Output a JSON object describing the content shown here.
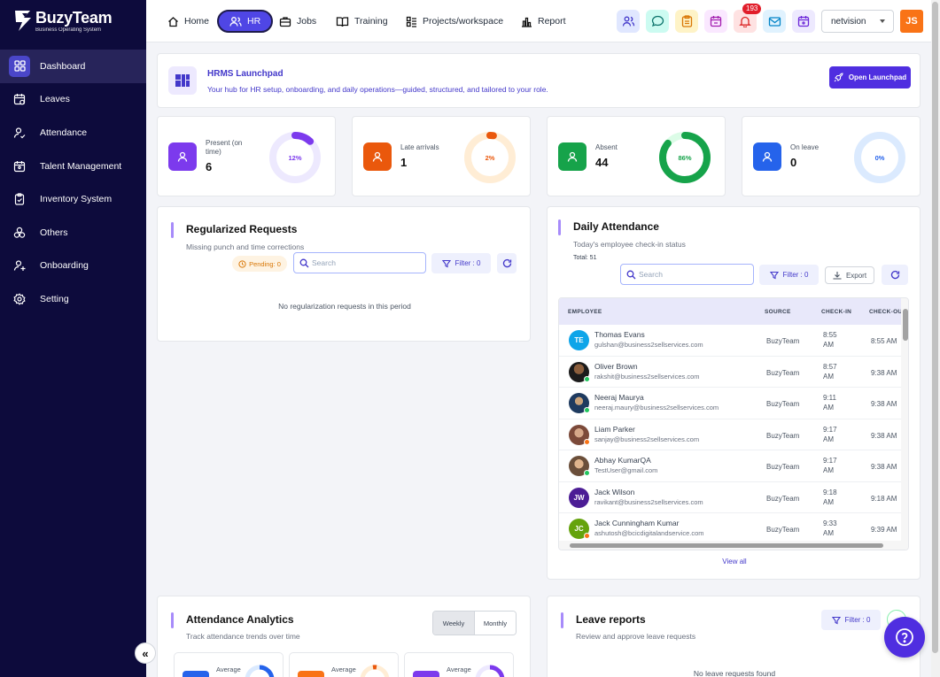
{
  "brand": {
    "name": "BuzyTeam",
    "tagline": "Business Operating System"
  },
  "sidebar": {
    "items": [
      {
        "label": "Dashboard",
        "icon": "grid-icon"
      },
      {
        "label": "Leaves",
        "icon": "calendar-icon"
      },
      {
        "label": "Attendance",
        "icon": "user-check-icon"
      },
      {
        "label": "Talent Management",
        "icon": "calendar-user-icon"
      },
      {
        "label": "Inventory System",
        "icon": "clipboard-icon"
      },
      {
        "label": "Others",
        "icon": "circles-icon"
      },
      {
        "label": "Onboarding",
        "icon": "user-plus-icon"
      },
      {
        "label": "Setting",
        "icon": "gear-icon"
      }
    ],
    "active": "Dashboard",
    "collapse_glyph": "«"
  },
  "topnav": {
    "tabs": [
      {
        "label": "Home",
        "icon": "home-icon"
      },
      {
        "label": "HR",
        "icon": "users-icon"
      },
      {
        "label": "Jobs",
        "icon": "briefcase-icon"
      },
      {
        "label": "Training",
        "icon": "book-icon"
      },
      {
        "label": "Projects/workspace",
        "icon": "workspace-icon"
      },
      {
        "label": "Report",
        "icon": "bar-chart-icon"
      }
    ],
    "active_tab": "HR",
    "notification_count": "193",
    "org_select": "netvision",
    "user_initials": "JS"
  },
  "launchpad": {
    "title": "HRMS Launchpad",
    "subtitle": "Your hub for HR setup, onboarding, and daily operations—guided, structured, and tailored to your role.",
    "button": "Open Launchpad"
  },
  "stats": [
    {
      "label": "Present (on time)",
      "value": "6",
      "percent": 12,
      "percent_label": "12%",
      "color": "#7c3aed",
      "track": "#ede9fe"
    },
    {
      "label": "Late arrivals",
      "value": "1",
      "percent": 2,
      "percent_label": "2%",
      "color": "#ea580c",
      "track": "#ffedd5"
    },
    {
      "label": "Absent",
      "value": "44",
      "percent": 86,
      "percent_label": "86%",
      "color": "#16a34a",
      "track": "#dcfce7"
    },
    {
      "label": "On leave",
      "value": "0",
      "percent": 0,
      "percent_label": "0%",
      "color": "#2563eb",
      "track": "#dbeafe"
    }
  ],
  "regularized": {
    "title": "Regularized Requests",
    "subtitle": "Missing punch and time corrections",
    "pending": "Pending: 0",
    "search_placeholder": "Search",
    "filter": "Filter : 0",
    "empty": "No regularization requests in this period"
  },
  "daily": {
    "title": "Daily Attendance",
    "subtitle": "Today's employee check-in status",
    "total": "Total: 51",
    "search_placeholder": "Search",
    "filter": "Filter : 0",
    "export": "Export",
    "columns": [
      "EMPLOYEE",
      "SOURCE",
      "CHECK-IN",
      "CHECK-OU"
    ],
    "rows": [
      {
        "name": "Thomas Evans",
        "email": "gulshan@business2sellservices.com",
        "source": "BuzyTeam",
        "check_in": "8:55 AM",
        "check_out": "8:55 AM",
        "initials": "TE",
        "avatar_color": "#0ea5e9",
        "status": ""
      },
      {
        "name": "Oliver Brown",
        "email": "rakshit@business2sellservices.com",
        "source": "BuzyTeam",
        "check_in": "8:57 AM",
        "check_out": "9:38 AM",
        "initials": "",
        "avatar_color": "#3b1f1f",
        "status": "#22c55e"
      },
      {
        "name": "Neeraj Maurya",
        "email": "neeraj.maury@business2sellservices.com",
        "source": "BuzyTeam",
        "check_in": "9:11 AM",
        "check_out": "9:38 AM",
        "initials": "",
        "avatar_color": "#1e3a5f",
        "status": "#22c55e"
      },
      {
        "name": "Liam Parker",
        "email": "sanjay@business2sellservices.com",
        "source": "BuzyTeam",
        "check_in": "9:17 AM",
        "check_out": "9:38 AM",
        "initials": "",
        "avatar_color": "#7c4a3a",
        "status": "#f97316"
      },
      {
        "name": "Abhay KumarQA",
        "email": "TestUser@gmail.com",
        "source": "BuzyTeam",
        "check_in": "9:17 AM",
        "check_out": "9:38 AM",
        "initials": "",
        "avatar_color": "#6b4f3a",
        "status": "#22c55e"
      },
      {
        "name": "Jack Wilson",
        "email": "ravikant@business2sellservices.com",
        "source": "BuzyTeam",
        "check_in": "9:18 AM",
        "check_out": "9:18 AM",
        "initials": "JW",
        "avatar_color": "#4c1d95",
        "status": ""
      },
      {
        "name": "Jack Cunningham Kumar",
        "email": "ashutosh@bcicdigitalandservice.com",
        "source": "BuzyTeam",
        "check_in": "9:33 AM",
        "check_out": "9:39 AM",
        "initials": "JC",
        "avatar_color": "#65a30d",
        "status": "#f97316"
      }
    ],
    "view_all": "View all"
  },
  "analytics": {
    "title": "Attendance Analytics",
    "subtitle": "Track attendance trends over time",
    "toggle": [
      "Weekly",
      "Monthly"
    ],
    "active_toggle": "Weekly",
    "mini_label": "Average"
  },
  "leave_reports": {
    "title": "Leave reports",
    "subtitle": "Review and approve leave requests",
    "filter": "Filter : 0",
    "empty": "No leave requests found"
  },
  "colors": {
    "sidebar_bg": "#0d0b3c",
    "accent": "#4f46e5",
    "launch_btn": "#4f2ee0"
  }
}
